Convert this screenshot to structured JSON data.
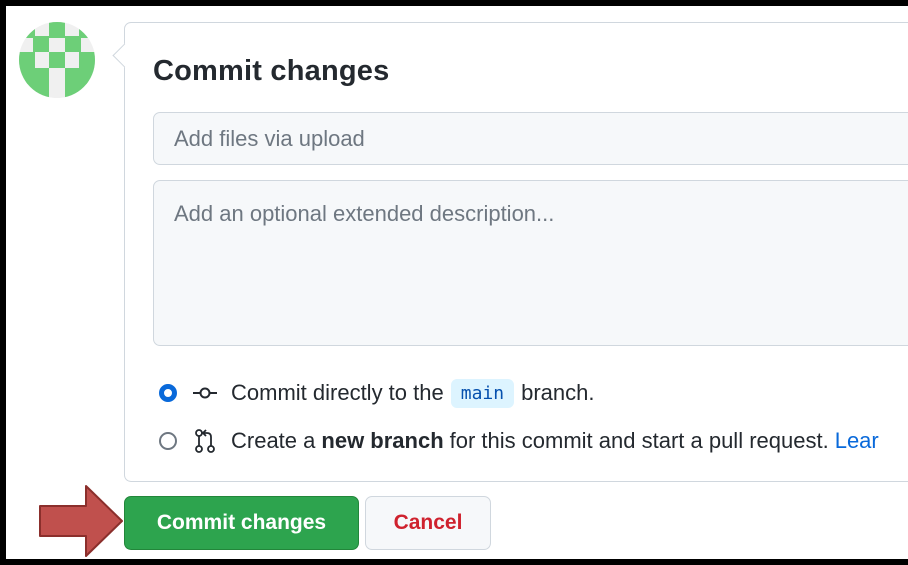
{
  "avatar": {
    "icon": "identicon-avatar",
    "color": "#6dcf78"
  },
  "commit_form": {
    "title": "Commit changes",
    "summary": {
      "value": "",
      "placeholder": "Add files via upload"
    },
    "description": {
      "value": "",
      "placeholder": "Add an optional extended description..."
    },
    "options": [
      {
        "selected": true,
        "icon": "git-commit-icon",
        "prefix": "Commit directly to the",
        "branch": "main",
        "suffix": "branch."
      },
      {
        "selected": false,
        "icon": "git-pull-request-icon",
        "prefix": "Create a",
        "bold": "new branch",
        "suffix": "for this commit and start a pull request.",
        "link": "Lear"
      }
    ]
  },
  "buttons": {
    "commit_label": "Commit changes",
    "cancel_label": "Cancel"
  },
  "annotation": {
    "icon": "right-arrow-annotation",
    "color": "#c0504d"
  },
  "colors": {
    "primary": "#2da44e",
    "danger": "#cf222e",
    "accent": "#0969da"
  }
}
